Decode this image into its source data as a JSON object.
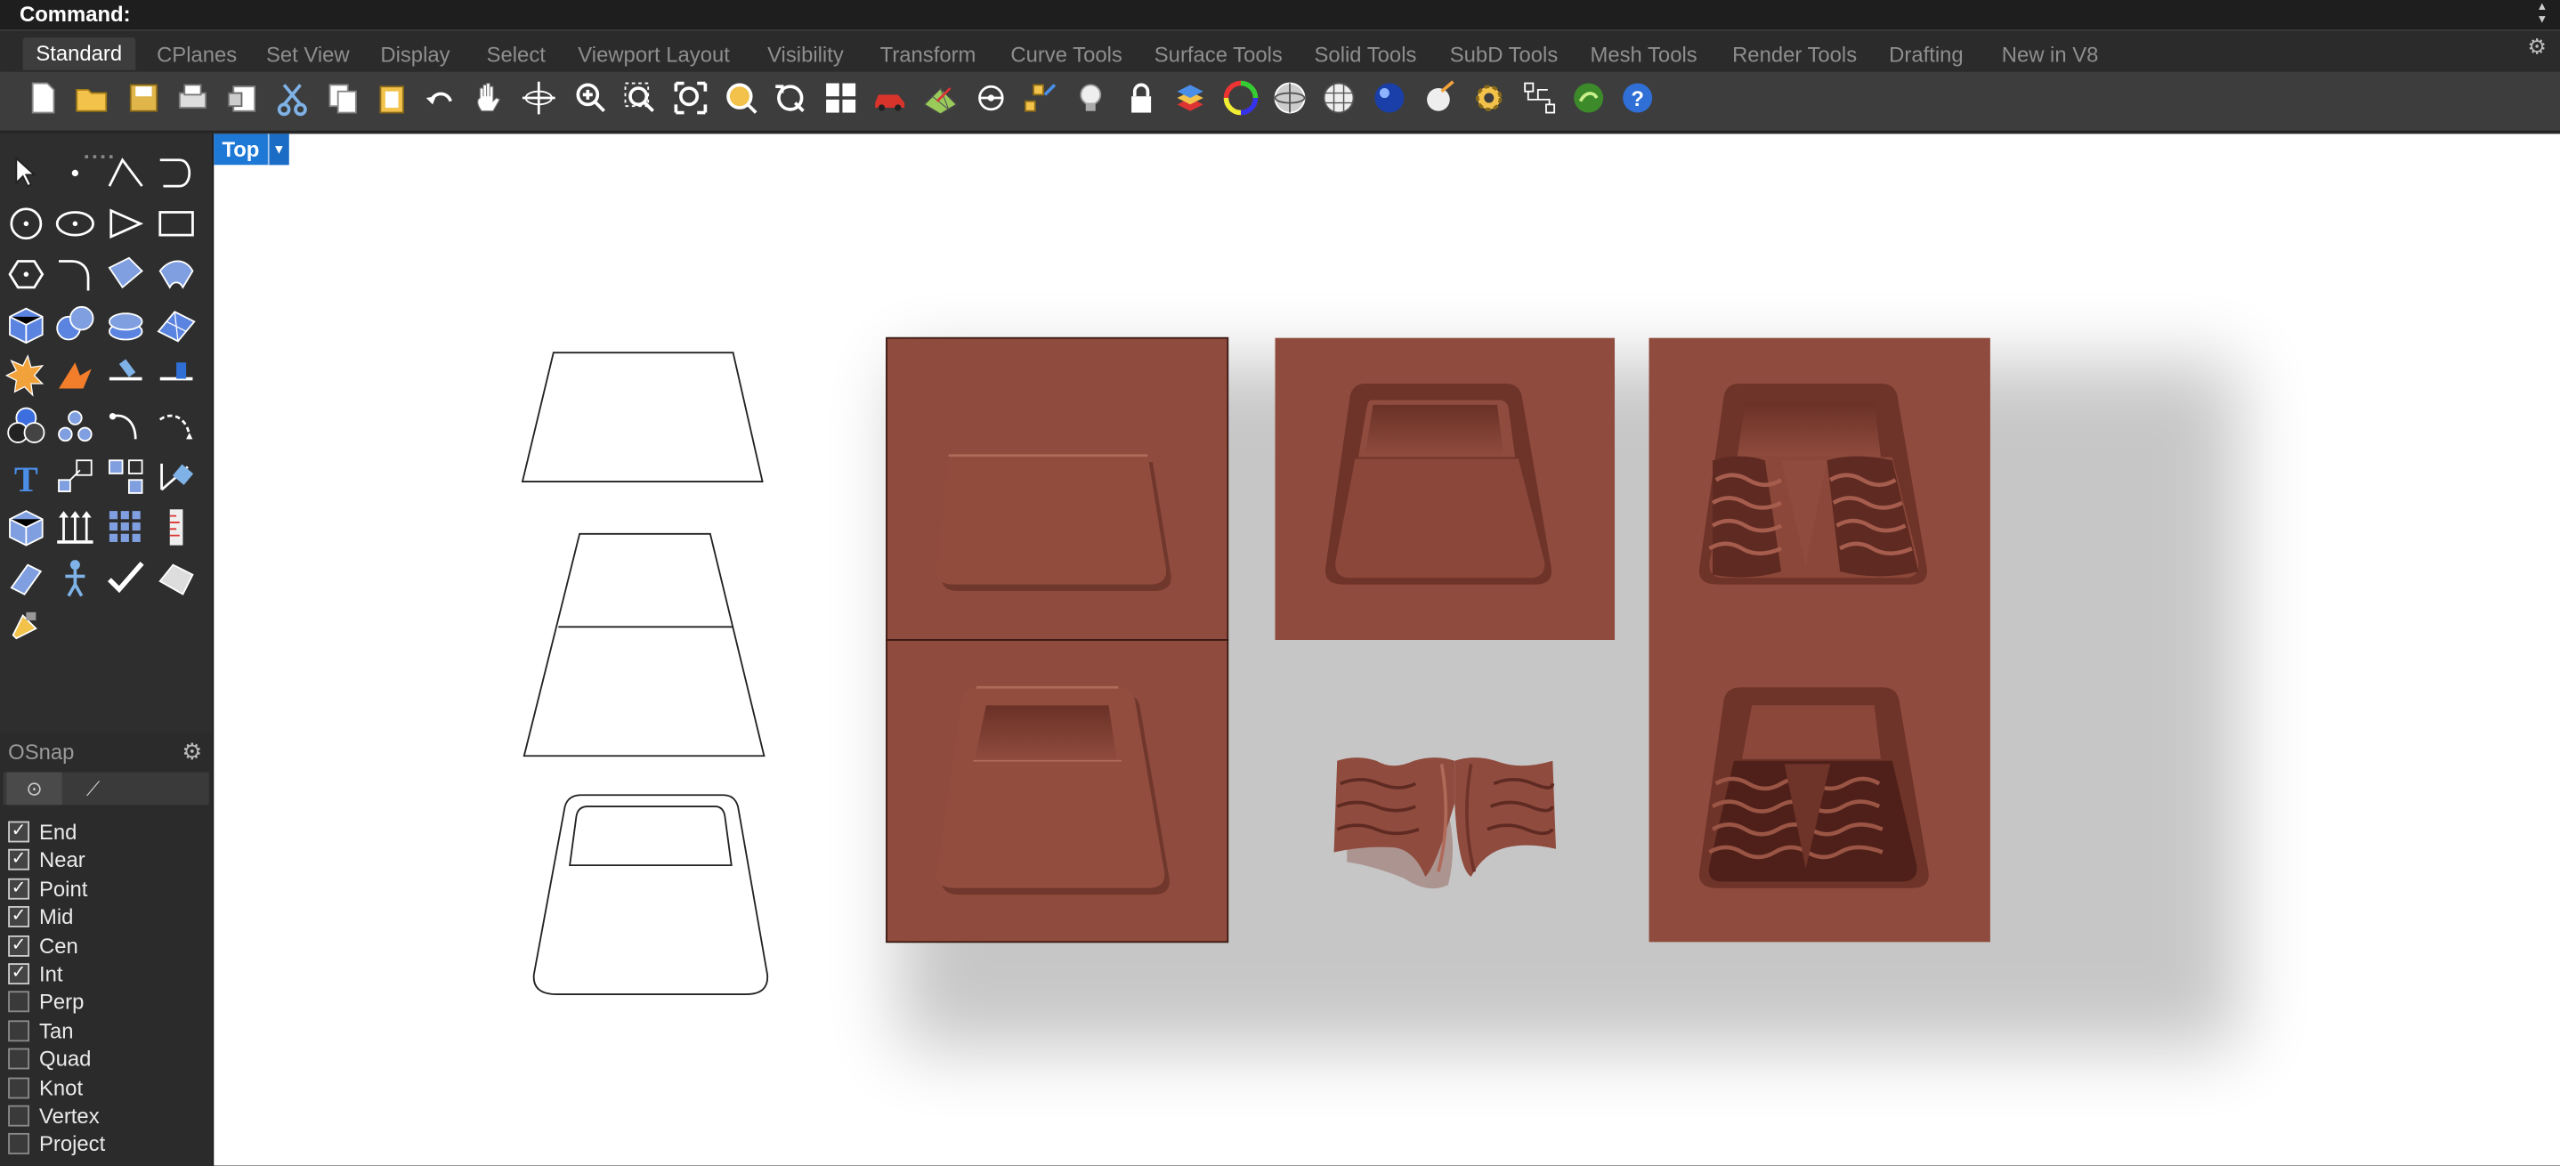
{
  "command": {
    "label": "Command:"
  },
  "tabs": [
    "Standard",
    "CPlanes",
    "Set View",
    "Display",
    "Select",
    "Viewport Layout",
    "Visibility",
    "Transform",
    "Curve Tools",
    "Surface Tools",
    "Solid Tools",
    "SubD Tools",
    "Mesh Tools",
    "Render Tools",
    "Drafting",
    "New in V8"
  ],
  "active_tab": "Standard",
  "toolbar_icons": [
    "new-icon",
    "open-icon",
    "save-icon",
    "print-icon",
    "import-icon",
    "cut-icon",
    "copy-icon",
    "paste-icon",
    "undo-icon",
    "pan-icon",
    "rotate-view-icon",
    "zoom-dynamic-icon",
    "zoom-window-icon",
    "zoom-extents-icon",
    "zoom-selected-icon",
    "undo-view-icon",
    "four-viewports-icon",
    "car-icon",
    "grid-icon",
    "cplane-icon",
    "gumball-icon",
    "light-icon",
    "lock-icon",
    "layers-icon",
    "color-wheel-icon",
    "shaded-sphere-icon",
    "mesh-sphere-icon",
    "render-sphere-icon",
    "lens-flare-icon",
    "gear-options-icon",
    "history-icon",
    "grasshopper-icon",
    "help-icon"
  ],
  "tools": [
    "select-arrow-icon",
    "point-icon",
    "polyline-icon",
    "curve-icon",
    "circle-icon",
    "ellipse-icon",
    "arc-icon",
    "rectangle-icon",
    "polygon-icon",
    "fillet-curve-icon",
    "surface-points-icon",
    "revolve-icon",
    "box-icon",
    "sphere-icon",
    "cylinder-icon",
    "plane-surface-icon",
    "explode-icon",
    "boolean-icon",
    "trim-icon",
    "split-icon",
    "color-circles-icon",
    "array-icon",
    "offset-icon",
    "rotate-icon",
    "text-icon",
    "scale-icon",
    "align-icon",
    "move-icon",
    "solid-box-icon",
    "extrude-arrows-icon",
    "array-grid-icon",
    "dimension-icon",
    "chamfer-icon",
    "person-icon",
    "check-icon",
    "shell-icon",
    "paint-icon"
  ],
  "osnap": {
    "title": "OSnap",
    "items": [
      {
        "label": "End",
        "checked": true
      },
      {
        "label": "Near",
        "checked": true
      },
      {
        "label": "Point",
        "checked": true
      },
      {
        "label": "Mid",
        "checked": true
      },
      {
        "label": "Cen",
        "checked": true
      },
      {
        "label": "Int",
        "checked": true
      },
      {
        "label": "Perp",
        "checked": false
      },
      {
        "label": "Tan",
        "checked": false
      },
      {
        "label": "Quad",
        "checked": false
      },
      {
        "label": "Knot",
        "checked": false
      },
      {
        "label": "Vertex",
        "checked": false
      },
      {
        "label": "Project",
        "checked": false
      }
    ]
  },
  "viewport": {
    "title": "Top"
  },
  "colors": {
    "accent": "#1e78d6",
    "terracotta": "#8f4b3d",
    "terracotta_dark": "#6e3329",
    "background": "#2b2b2b",
    "viewport_bg": "#ffffff"
  }
}
